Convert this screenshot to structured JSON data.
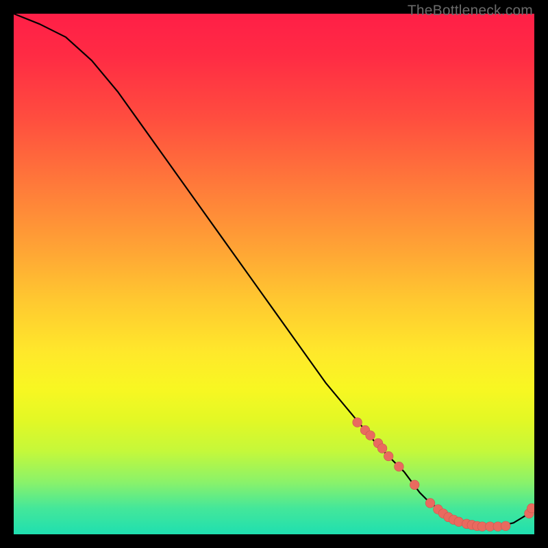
{
  "watermark": "TheBottleneck.com",
  "colors": {
    "background": "#000000",
    "curve": "#000000",
    "point_fill": "#e96a5f",
    "point_stroke": "#c9584f"
  },
  "chart_data": {
    "type": "line",
    "title": "",
    "xlabel": "",
    "ylabel": "",
    "xlim": [
      0,
      100
    ],
    "ylim": [
      0,
      100
    ],
    "series": [
      {
        "name": "bottleneck-curve",
        "x": [
          0,
          5,
          10,
          15,
          20,
          25,
          30,
          35,
          40,
          45,
          50,
          55,
          60,
          65,
          70,
          75,
          78,
          80,
          83,
          86,
          90,
          93,
          96,
          99,
          100
        ],
        "y": [
          100,
          98,
          95.5,
          91,
          85,
          78,
          71,
          64,
          57,
          50,
          43,
          36,
          29,
          23,
          17,
          12,
          8,
          6,
          4,
          2.5,
          1.5,
          1.5,
          2.2,
          4,
          5
        ]
      }
    ],
    "scatter_points": {
      "name": "highlight-points",
      "x": [
        66,
        67.5,
        68.5,
        70,
        70.8,
        72,
        74,
        77,
        80,
        81.5,
        82.5,
        83.5,
        84.5,
        85.5,
        87,
        88,
        89,
        90,
        91.5,
        93,
        94.5,
        99,
        99.5
      ],
      "y": [
        21.5,
        20,
        19,
        17.5,
        16.5,
        15,
        13,
        9.5,
        6,
        4.8,
        4,
        3.3,
        2.8,
        2.4,
        2,
        1.8,
        1.6,
        1.5,
        1.5,
        1.5,
        1.6,
        4,
        5
      ]
    }
  }
}
